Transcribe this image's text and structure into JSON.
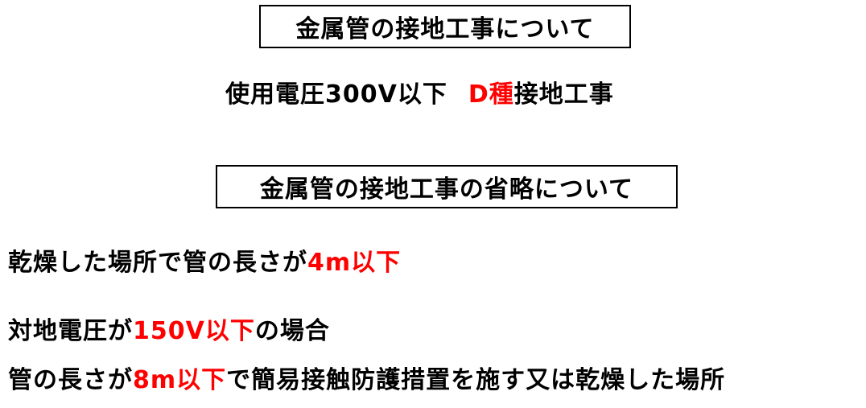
{
  "heading_1": "金属管の接地工事について",
  "line_1": {
    "before": "使用電圧300V以下",
    "red": "D種",
    "after": "接地工事"
  },
  "heading_2": "金属管の接地工事の省略について",
  "line_2": {
    "before": "乾燥した場所で管の長さが",
    "red": "4m以下"
  },
  "line_3": {
    "before": "対地電圧が",
    "red": "150V以下",
    "after": "の場合"
  },
  "line_4": {
    "before": "管の長さが",
    "red": "8m以下",
    "after": "で簡易接触防護措置を施す又は乾燥した場所"
  },
  "colors": {
    "highlight": "#ff0000",
    "text": "#000000",
    "background": "#ffffff"
  }
}
